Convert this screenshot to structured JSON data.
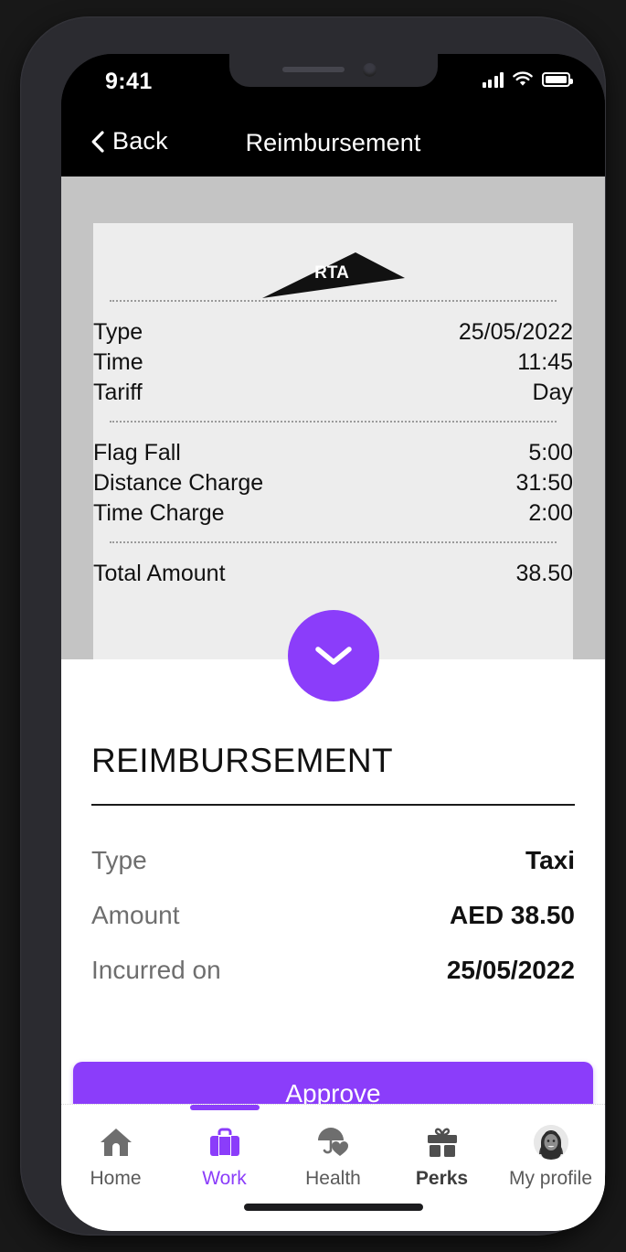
{
  "status_bar": {
    "time": "9:41",
    "signal_icon": "cellular-signal-icon",
    "wifi_icon": "wifi-icon",
    "battery_icon": "battery-full-icon"
  },
  "nav_bar": {
    "back_label": "Back",
    "back_icon": "chevron-left-icon",
    "title": "Reimbursement"
  },
  "receipt": {
    "logo_text": "RTA",
    "logo_name": "rta-logo",
    "section_trip": [
      {
        "label": "Type",
        "value": "25/05/2022"
      },
      {
        "label": "Time",
        "value": "11:45"
      },
      {
        "label": "Tariff",
        "value": "Day"
      }
    ],
    "section_charges": [
      {
        "label": "Flag Fall",
        "value": "5:00"
      },
      {
        "label": "Distance Charge",
        "value": "31:50"
      },
      {
        "label": "Time Charge",
        "value": "2:00"
      }
    ],
    "section_total": [
      {
        "label": "Total Amount",
        "value": "38.50"
      }
    ]
  },
  "expand_button": {
    "icon": "chevron-down-icon",
    "color": "#8B3DFA"
  },
  "sheet": {
    "title": "REIMBURSEMENT",
    "rows": [
      {
        "label": "Type",
        "value": "Taxi"
      },
      {
        "label": "Amount",
        "value": "AED 38.50"
      },
      {
        "label": "Incurred on",
        "value": "25/05/2022"
      }
    ],
    "approve_label": "Approve"
  },
  "tab_bar": {
    "items": [
      {
        "label": "Home",
        "icon": "home-icon",
        "active": false
      },
      {
        "label": "Work",
        "icon": "briefcase-icon",
        "active": true
      },
      {
        "label": "Health",
        "icon": "umbrella-heart-icon",
        "active": false
      },
      {
        "label": "Perks",
        "icon": "gift-icon",
        "active": false
      },
      {
        "label": "My profile",
        "icon": "avatar-icon",
        "active": false
      }
    ]
  },
  "theme": {
    "accent": "#8B3DFA",
    "receipt_bg": "#ededed",
    "stage_bg": "#c4c4c4"
  }
}
